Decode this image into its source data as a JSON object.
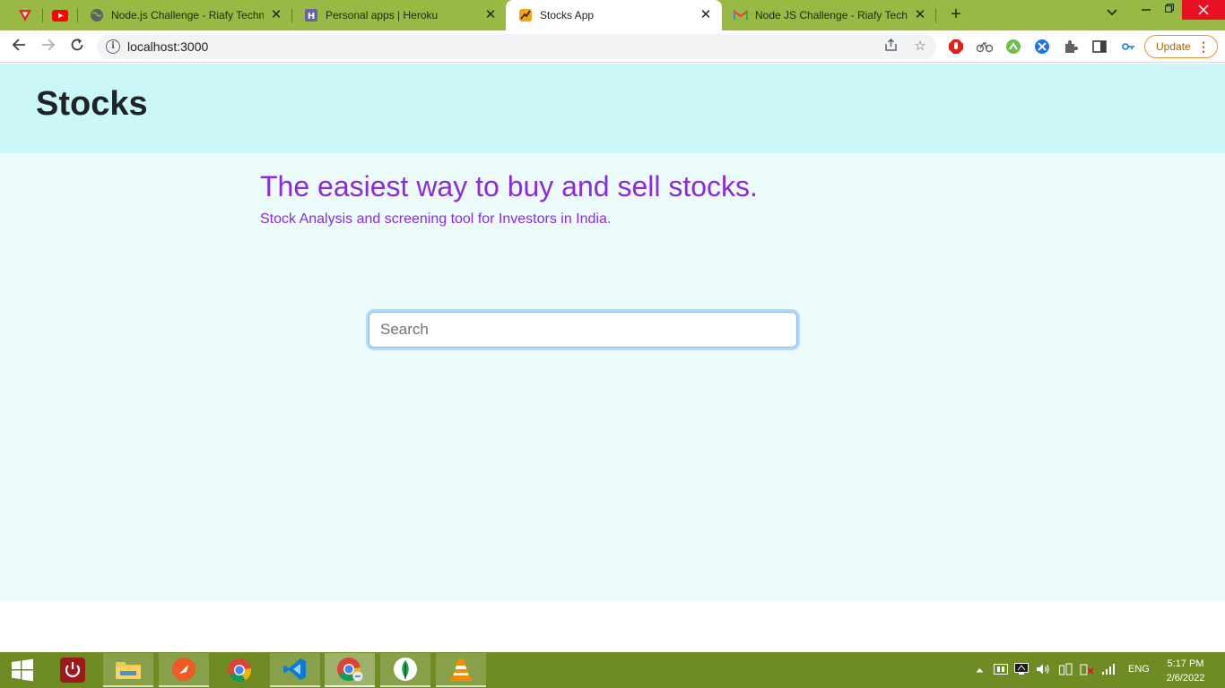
{
  "browser": {
    "tabs": [
      {
        "title": "Node.js Challenge - Riafy Technologies",
        "favicon": "globe-icon",
        "active": false
      },
      {
        "title": "Personal apps | Heroku",
        "favicon": "heroku-icon",
        "active": false
      },
      {
        "title": "Stocks App",
        "favicon": "stocks-app-icon",
        "active": true
      },
      {
        "title": "Node JS Challenge - Riafy Technologies",
        "favicon": "gmail-icon",
        "active": false
      }
    ],
    "url": "localhost:3000",
    "update_label": "Update",
    "accent_color": "#98b944"
  },
  "page": {
    "header_title": "Stocks",
    "tagline": "The easiest way to buy and sell stocks.",
    "subtitle": "Stock Analysis and screening tool for Investors in India.",
    "search": {
      "placeholder": "Search",
      "value": ""
    },
    "colors": {
      "header_bg": "#cbf7f9",
      "main_bg": "#ecfcfd",
      "accent": "#8a2be2"
    }
  },
  "taskbar": {
    "apps": [
      "windows-start",
      "power-app",
      "file-explorer",
      "postman",
      "chrome",
      "vscode",
      "chrome-profile",
      "mongodb-compass",
      "vlc"
    ],
    "language": "ENG",
    "time": "5:17 PM",
    "date": "2/6/2022"
  }
}
